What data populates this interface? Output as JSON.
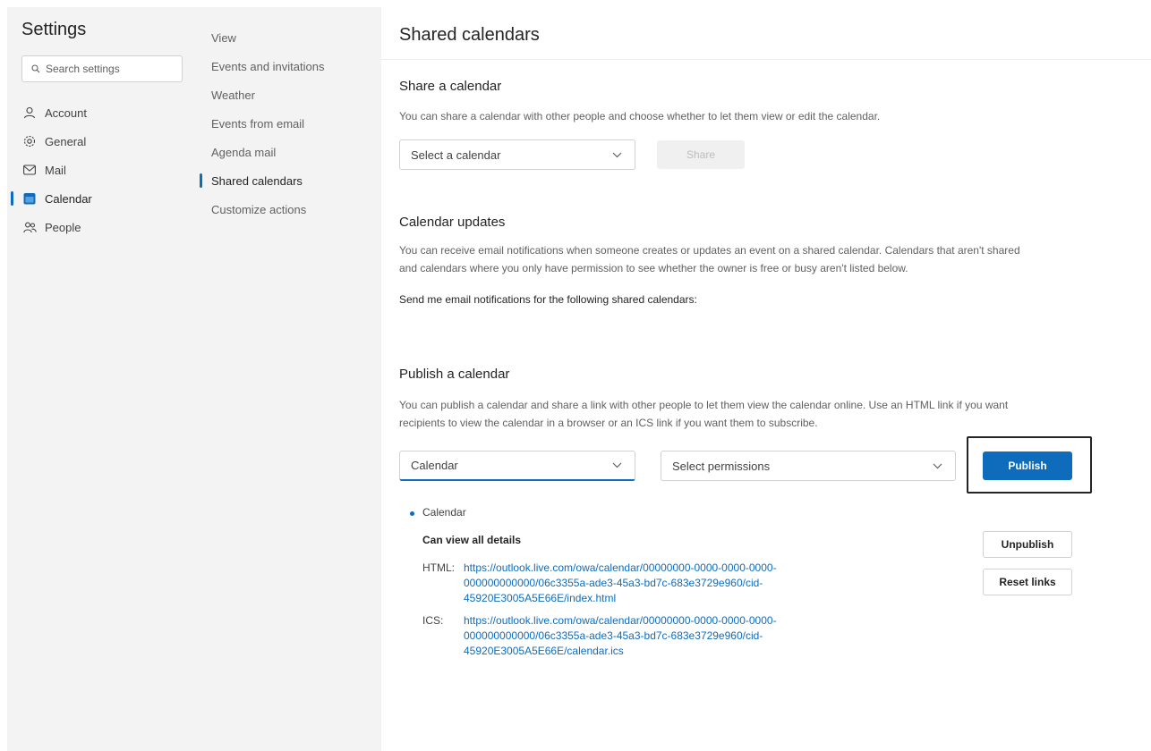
{
  "sidebar": {
    "title": "Settings",
    "search_placeholder": "Search settings",
    "categories": [
      {
        "label": "Account",
        "icon": "person-icon"
      },
      {
        "label": "General",
        "icon": "gear-icon"
      },
      {
        "label": "Mail",
        "icon": "mail-icon"
      },
      {
        "label": "Calendar",
        "icon": "calendar-icon",
        "selected": true
      },
      {
        "label": "People",
        "icon": "people-icon"
      }
    ],
    "subnav": [
      {
        "label": "View"
      },
      {
        "label": "Events and invitations"
      },
      {
        "label": "Weather"
      },
      {
        "label": "Events from email"
      },
      {
        "label": "Agenda mail"
      },
      {
        "label": "Shared calendars",
        "selected": true
      },
      {
        "label": "Customize actions"
      }
    ]
  },
  "main": {
    "title": "Shared calendars",
    "share": {
      "heading": "Share a calendar",
      "description": "You can share a calendar with other people and choose whether to let them view or edit the calendar.",
      "select_value": "Select a calendar",
      "share_button": "Share"
    },
    "updates": {
      "heading": "Calendar updates",
      "description_line1": "You can receive email notifications when someone creates or updates an event on a shared calendar. Calendars that aren't shared",
      "description_line2": "and calendars where you only have permission to see whether the owner is free or busy aren't listed below.",
      "notifications_label": "Send me email notifications for the following shared calendars:"
    },
    "publish": {
      "heading": "Publish a calendar",
      "description_line1": "You can publish a calendar and share a link with other people to let them view the calendar online. Use an HTML link if you want",
      "description_line2": "recipients to view the calendar in a browser or an ICS link if you want them to subscribe.",
      "calendar_select": "Calendar",
      "permissions_select": "Select permissions",
      "publish_button": "Publish",
      "published_calendar": "Calendar",
      "permission_label": "Can view all details",
      "html_label": "HTML:",
      "html_link": [
        "https://outlook.live.com/owa/calendar/00000000-0000-0000-0000-",
        "000000000000/06c3355a-ade3-45a3-bd7c-683e3729e960/cid-",
        "45920E3005A5E66E/index.html"
      ],
      "ics_label": "ICS:",
      "ics_link": [
        "https://outlook.live.com/owa/calendar/00000000-0000-0000-0000-",
        "000000000000/06c3355a-ade3-45a3-bd7c-683e3729e960/cid-",
        "45920E3005A5E66E/calendar.ics"
      ],
      "unpublish_button": "Unpublish",
      "reset_button": "Reset links"
    }
  },
  "colors": {
    "accent": "#0f6cbd",
    "pane_bg": "#f3f3f3",
    "muted_text": "#616161"
  }
}
